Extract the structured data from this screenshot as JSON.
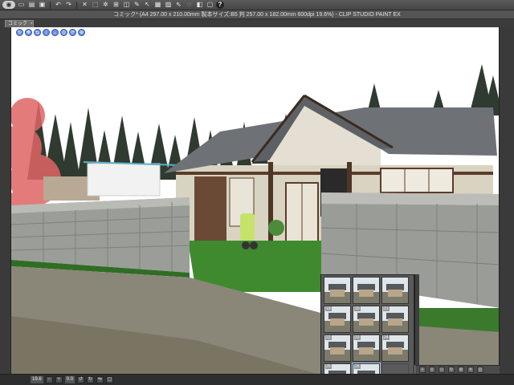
{
  "app": {
    "title": "コミック* (A4 297.00 x 210.00mm 製本サイズ:B5 判 257.00 x 182.00mm 600dpi 19.6%) - CLIP STUDIO PAINT EX"
  },
  "toolbar": {
    "menu_icon": "menu-icon",
    "buttons": [
      "new-icon",
      "open-icon",
      "save-icon",
      "undo-icon",
      "redo-icon",
      "clear-icon",
      "transform-icon",
      "rotate-icon",
      "snap-icon",
      "ruler-icon",
      "draw-icon",
      "select-icon",
      "help-icon"
    ],
    "help_label": "?"
  },
  "tabs": [
    {
      "label": "コミック*",
      "close_glyph": "×"
    }
  ],
  "canvas": {
    "object_tools": [
      "↻",
      "✥",
      "⇆",
      "↕",
      "↔",
      "◎",
      "⟳",
      "⊕"
    ]
  },
  "status": {
    "zoom": "19.6",
    "rotation": "0.0"
  },
  "material_panel": {
    "rows": [
      [
        {
          "num": "",
          "filled": true
        },
        {
          "num": "",
          "filled": true
        },
        {
          "num": "",
          "filled": true
        }
      ],
      [
        {
          "num": "19",
          "filled": true
        },
        {
          "num": "20",
          "filled": true
        },
        {
          "num": "21",
          "filled": true
        }
      ],
      [
        {
          "num": "22",
          "filled": true
        },
        {
          "num": "23",
          "filled": true
        },
        {
          "num": "24",
          "filled": true
        }
      ],
      [
        {
          "num": "25",
          "filled": true
        },
        {
          "num": "26",
          "filled": true,
          "selected": true
        },
        {
          "num": "",
          "filled": false
        }
      ]
    ]
  },
  "colors": {
    "sky": "#ffffff",
    "roof": "#6c7074",
    "wall": "#d8d2c0",
    "block_wall": "#9a9c98",
    "lawn": "#3f8a2e",
    "path": "#7a786c",
    "trees": "#2e3a2e",
    "maple": "#e06060"
  }
}
